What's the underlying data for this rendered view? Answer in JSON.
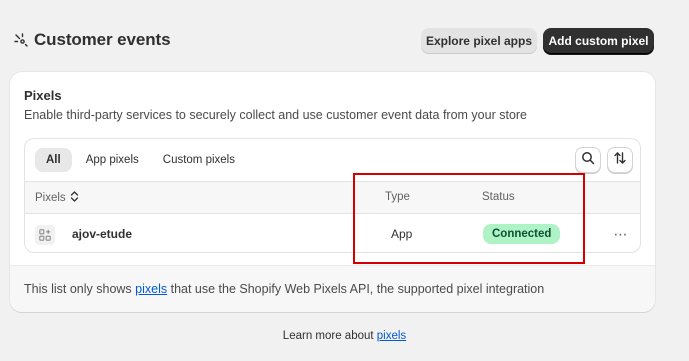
{
  "header": {
    "title": "Customer events",
    "title_icon": "customer-events-icon",
    "explore_button": "Explore pixel apps",
    "add_button": "Add custom pixel"
  },
  "card": {
    "title": "Pixels",
    "description": "Enable third-party services to securely collect and use customer event data from your store",
    "tabs": [
      {
        "label": "All",
        "active": true
      },
      {
        "label": "App pixels",
        "active": false
      },
      {
        "label": "Custom pixels",
        "active": false
      }
    ],
    "search_icon": "search-icon",
    "sort_icon": "sort-icon",
    "columns": {
      "pixels": "Pixels",
      "type": "Type",
      "status": "Status"
    },
    "rows": [
      {
        "name": "ajov-etude",
        "type": "App",
        "status": "Connected",
        "icon": "app-grid-icon",
        "more": "⋯"
      }
    ],
    "footer": {
      "prefix": "This list only shows ",
      "link": "pixels",
      "suffix": " that use the Shopify Web Pixels API, the supported pixel integration"
    }
  },
  "learn_more": {
    "prefix": "Learn more about ",
    "link": "pixels"
  },
  "colors": {
    "accent": "#303030",
    "link": "#005bd3",
    "status_bg": "#aff2c6",
    "status_text": "#0c5132",
    "highlight": "#d40000"
  }
}
